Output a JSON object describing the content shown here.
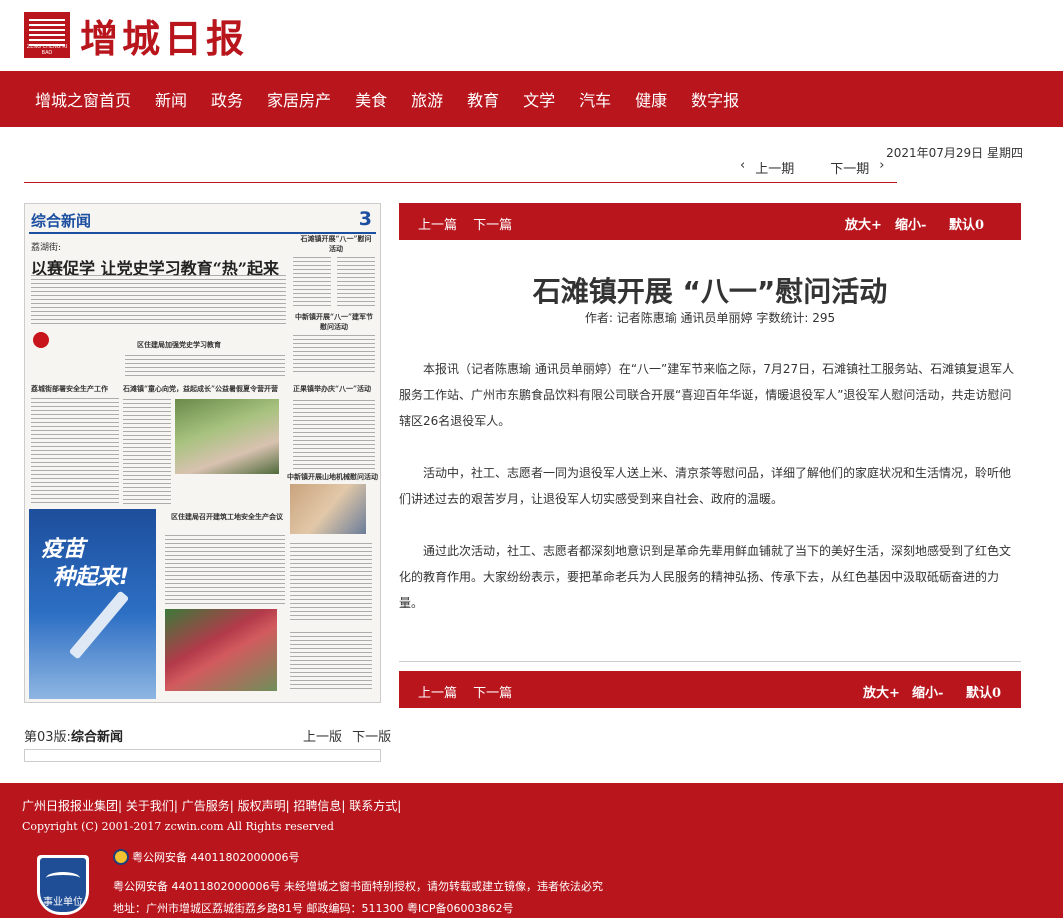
{
  "logo": {
    "mark_sub": "ZENG CHENG RI BAO",
    "name": "增城日报"
  },
  "nav": [
    "增城之窗首页",
    "新闻",
    "政务",
    "家居房产",
    "美食",
    "旅游",
    "教育",
    "文学",
    "汽车",
    "健康",
    "数字报"
  ],
  "date": "2021年07月29日  星期四",
  "issue_nav": {
    "prev": "上一期",
    "next": "下一期",
    "prev_icon": "chevron-left-icon",
    "next_icon": "chevron-right-icon"
  },
  "paper": {
    "section": "综合新闻",
    "page_no": "3",
    "headline_kicker": "荔湖街:",
    "headline": "以赛促学  让党史学习教育“热”起来",
    "side_title1": "石滩镇开展“八一”慰问活动",
    "side_title2": "中新镇开展“八一”建军节慰问活动",
    "mid_title": "区住建局加强党史学习教育",
    "row_title1": "荔城街部署安全生产工作",
    "row_title2": "石滩镇“童心向党，益起成长”公益暑假夏令营开营",
    "row_title3": "正果镇举办庆“八一”活动",
    "row_title4": "中新镇开展山地机械慰问活动",
    "row_title5": "区住建局召开建筑工地安全生产会议",
    "vax_line1": "疫苗",
    "vax_line2": "种起来!"
  },
  "page_label": {
    "prefix": "第03版:",
    "name": "综合新闻"
  },
  "page_nav": {
    "prev": "上一版",
    "next": "下一版"
  },
  "toolbar": {
    "prev": "上一篇",
    "next": "下一篇",
    "zoom_in": "放大+",
    "zoom_out": "缩小-",
    "default": "默认0"
  },
  "article": {
    "title": "石滩镇开展 “八一”慰问活动",
    "meta": "作者: 记者陈惠瑜 通讯员单丽婷  字数统计: 295",
    "paragraphs": [
      "本报讯（记者陈惠瑜 通讯员单丽婷）在“八一”建军节来临之际，7月27日，石滩镇社工服务站、石滩镇复退军人服务工作站、广州市东鹏食品饮料有限公司联合开展“喜迎百年华诞，情暖退役军人”退役军人慰问活动，共走访慰问辖区26名退役军人。",
      "活动中，社工、志愿者一同为退役军人送上米、清京茶等慰问品，详细了解他们的家庭状况和生活情况，聆听他们讲述过去的艰苦岁月，让退役军人切实感受到来自社会、政府的温暖。",
      "通过此次活动，社工、志愿者都深刻地意识到是革命先辈用鲜血铺就了当下的美好生活，深刻地感受到了红色文化的教育作用。大家纷纷表示，要把革命老兵为人民服务的精神弘扬、传承下去，从红色基因中汲取砥砺奋进的力量。"
    ]
  },
  "footer": {
    "links": "广州日报报业集团| 关于我们| 广告服务| 版权声明| 招聘信息| 联系方式|",
    "copyright": "Copyright (C) 2001-2017 zcwin.com All Rights reserved",
    "badge_text": "事业单位",
    "police": "粤公网安备 44011802000006号",
    "line2": "粤公网安备 44011802000006号 未经增城之窗书面特别授权，请勿转载或建立镜像，违者依法必究",
    "line3": "地址：广州市增城区荔城街荔乡路81号 邮政编码：511300 粤ICP备06003862号"
  }
}
